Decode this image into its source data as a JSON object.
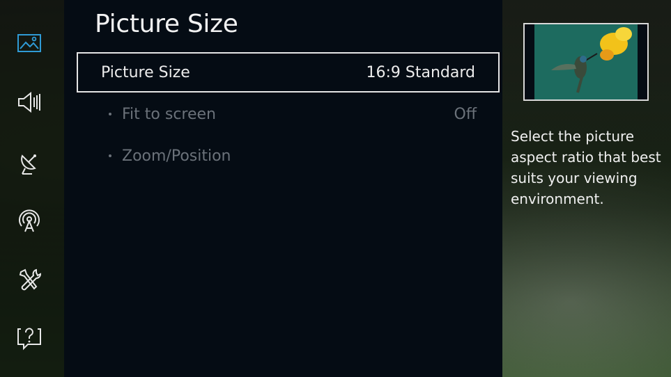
{
  "menu": {
    "title": "Picture Size",
    "items": [
      {
        "label": "Picture Size",
        "value": "16:9 Standard",
        "selected": true
      },
      {
        "label": "Fit to screen",
        "value": "Off",
        "selected": false
      },
      {
        "label": "Zoom/Position",
        "value": "",
        "selected": false
      }
    ]
  },
  "sidebar": {
    "icons": [
      "picture-icon",
      "sound-icon",
      "broadcasting-icon",
      "network-icon",
      "system-tools-icon",
      "support-icon"
    ]
  },
  "help": {
    "description": "Select the picture aspect ratio that best suits your viewing environment."
  },
  "colors": {
    "panel_bg": "#050c14",
    "sidebar_active": "#2f9bd6",
    "text_primary": "#ececec",
    "text_disabled": "#6b727a"
  }
}
